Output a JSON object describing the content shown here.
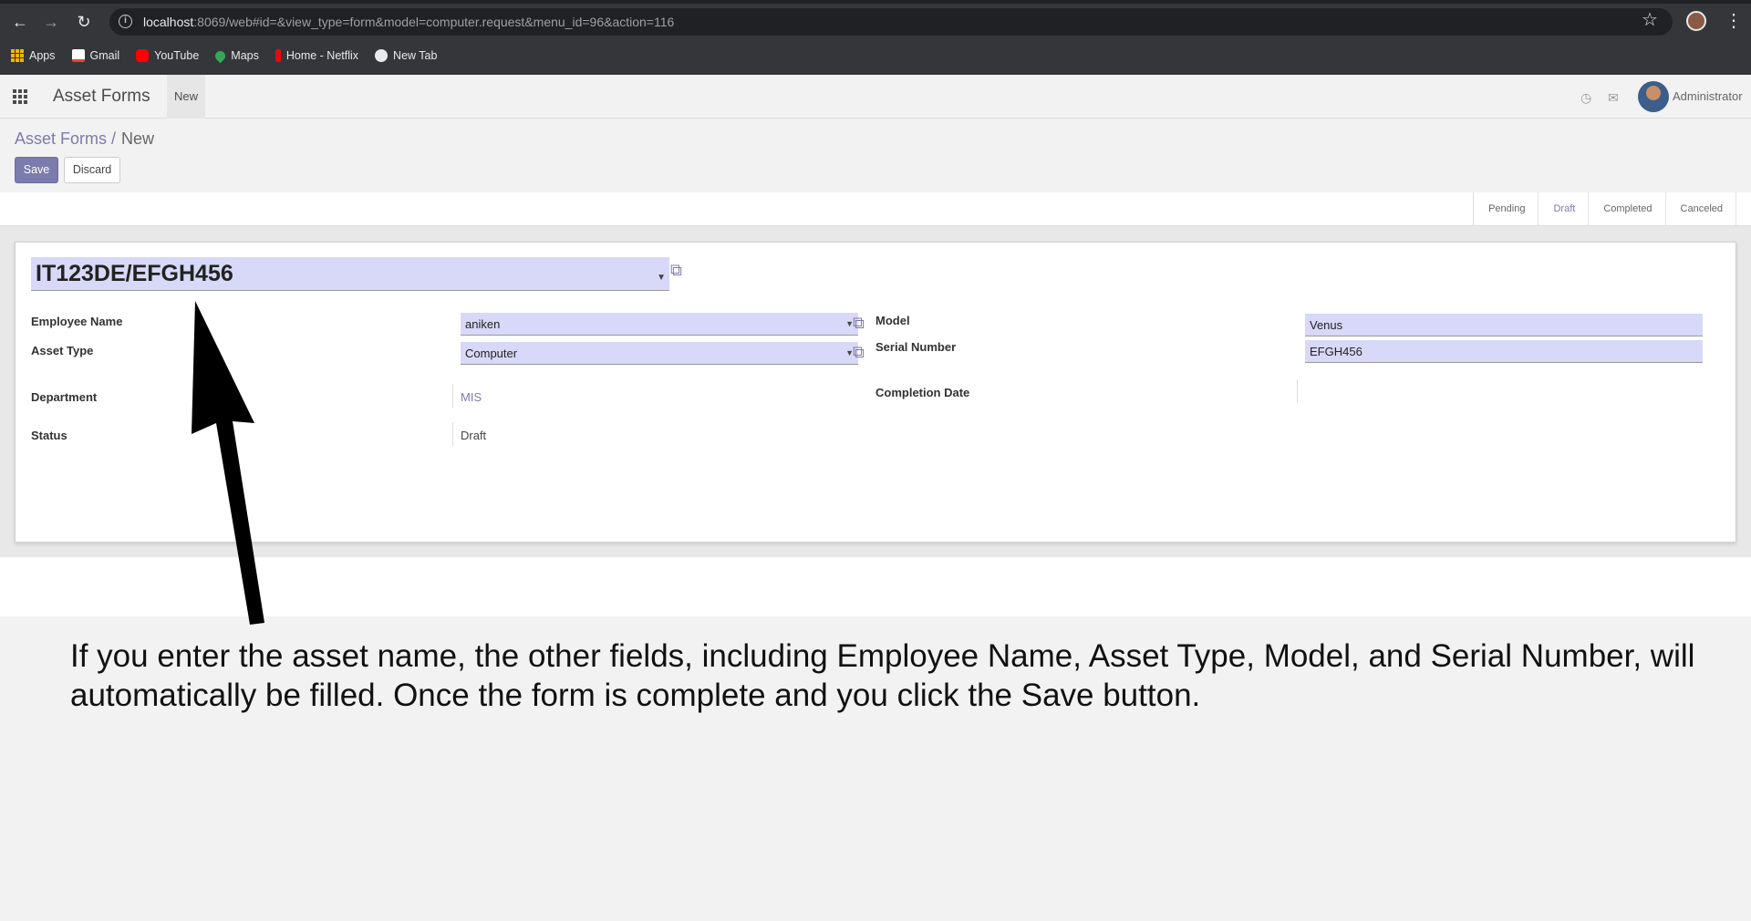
{
  "browser": {
    "url_host": "localhost",
    "url_rest": ":8069/web#id=&view_type=form&model=computer.request&menu_id=96&action=116",
    "bookmarks": [
      {
        "label": "Apps",
        "icon": "apps-grid-icon"
      },
      {
        "label": "Gmail",
        "icon": "gmail-icon"
      },
      {
        "label": "YouTube",
        "icon": "youtube-icon"
      },
      {
        "label": "Maps",
        "icon": "maps-icon"
      },
      {
        "label": "Home - Netflix",
        "icon": "netflix-icon"
      },
      {
        "label": "New Tab",
        "icon": "globe-icon"
      }
    ]
  },
  "navbar": {
    "app_name": "Asset Forms",
    "new_menu": "New",
    "user_name": "Administrator"
  },
  "control_panel": {
    "breadcrumb_parent": "Asset Forms /",
    "breadcrumb_current": "New",
    "save_label": "Save",
    "discard_label": "Discard"
  },
  "statusbar": {
    "steps": [
      "Pending",
      "Draft",
      "Completed",
      "Canceled"
    ],
    "active": "Draft"
  },
  "form": {
    "asset_name": "IT123DE/EFGH456",
    "employee_name_label": "Employee Name",
    "employee_name_value": "aniken",
    "asset_type_label": "Asset Type",
    "asset_type_value": "Computer",
    "department_label": "Department",
    "department_value": "MIS",
    "status_label": "Status",
    "status_value": "Draft",
    "model_label": "Model",
    "model_value": "Venus",
    "serial_label": "Serial Number",
    "serial_value": "EFGH456",
    "completion_label": "Completion Date",
    "completion_value": ""
  },
  "annotation": {
    "caption": "If you enter the asset name, the other fields, including Employee Name, Asset Type, Model, and Serial Number, will automatically be filled. Once the form is complete and you click the Save button."
  },
  "colors": {
    "accent": "#7c7bad",
    "field_bg": "#d8d8f8",
    "chrome_dark": "#35363a"
  }
}
